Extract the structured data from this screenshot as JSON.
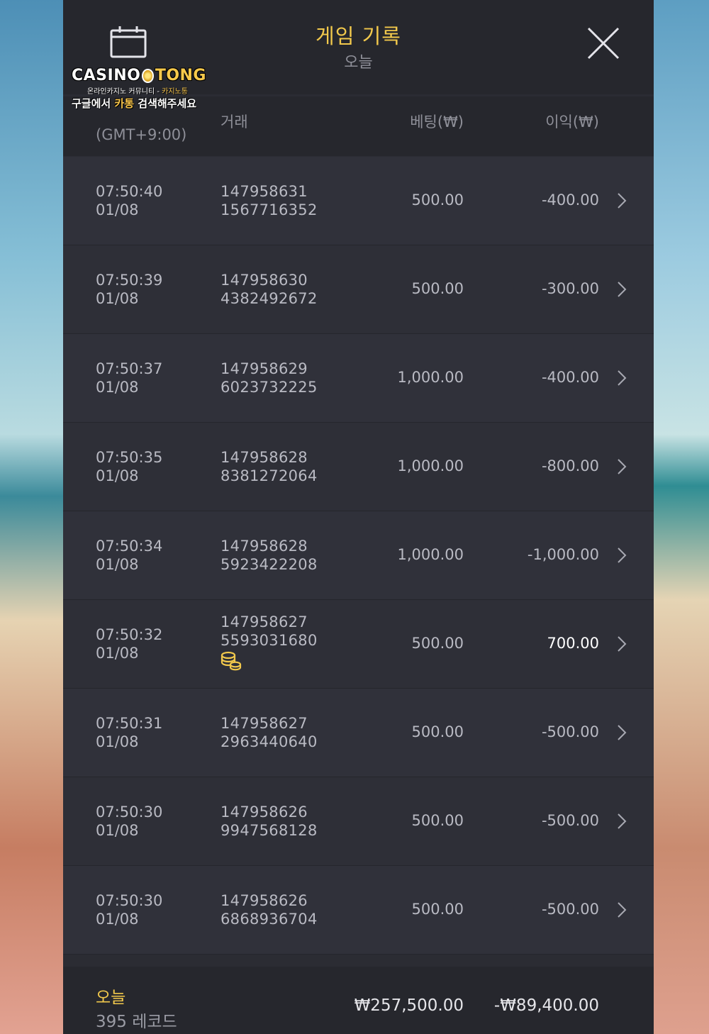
{
  "header": {
    "title": "게임 기록",
    "subtitle": "오늘"
  },
  "logo": {
    "main_left": "CASINO",
    "main_right": "TONG",
    "sub1_left": "온라인카지노 커뮤니티 - ",
    "sub1_right": "카지노통",
    "sub2_left": "구글에서 ",
    "sub2_mid": "카통",
    "sub2_right": " 검색해주세요"
  },
  "columns": {
    "time": "(GMT+9:00)",
    "transaction": "거래",
    "bet": "베팅(₩)",
    "profit": "이익(₩)"
  },
  "rows": [
    {
      "time": "07:50:40",
      "date": "01/08",
      "id1": "147958631",
      "id2": "1567716352",
      "bet": "500.00",
      "profit": "-400.00"
    },
    {
      "time": "07:50:39",
      "date": "01/08",
      "id1": "147958630",
      "id2": "4382492672",
      "bet": "500.00",
      "profit": "-300.00"
    },
    {
      "time": "07:50:37",
      "date": "01/08",
      "id1": "147958629",
      "id2": "6023732225",
      "bet": "1,000.00",
      "profit": "-400.00"
    },
    {
      "time": "07:50:35",
      "date": "01/08",
      "id1": "147958628",
      "id2": "8381272064",
      "bet": "1,000.00",
      "profit": "-800.00"
    },
    {
      "time": "07:50:34",
      "date": "01/08",
      "id1": "147958628",
      "id2": "5923422208",
      "bet": "1,000.00",
      "profit": "-1,000.00"
    },
    {
      "time": "07:50:32",
      "date": "01/08",
      "id1": "147958627",
      "id2": "5593031680",
      "bet": "500.00",
      "profit": "700.00"
    },
    {
      "time": "07:50:31",
      "date": "01/08",
      "id1": "147958627",
      "id2": "2963440640",
      "bet": "500.00",
      "profit": "-500.00"
    },
    {
      "time": "07:50:30",
      "date": "01/08",
      "id1": "147958626",
      "id2": "9947568128",
      "bet": "500.00",
      "profit": "-500.00"
    },
    {
      "time": "07:50:30",
      "date": "01/08",
      "id1": "147958626",
      "id2": "6868936704",
      "bet": "500.00",
      "profit": "-500.00"
    }
  ],
  "footer": {
    "label": "오늘",
    "count": "395 레코드",
    "total_bet": "₩257,500.00",
    "total_profit": "-₩89,400.00"
  },
  "icons": {
    "calendar": "calendar-icon",
    "close": "close-icon",
    "chevron": "chevron-right-icon",
    "coins": "coins-icon"
  },
  "colors": {
    "accent": "#f2c94c",
    "panel": "#2b2c33",
    "text": "#b9bac3"
  }
}
